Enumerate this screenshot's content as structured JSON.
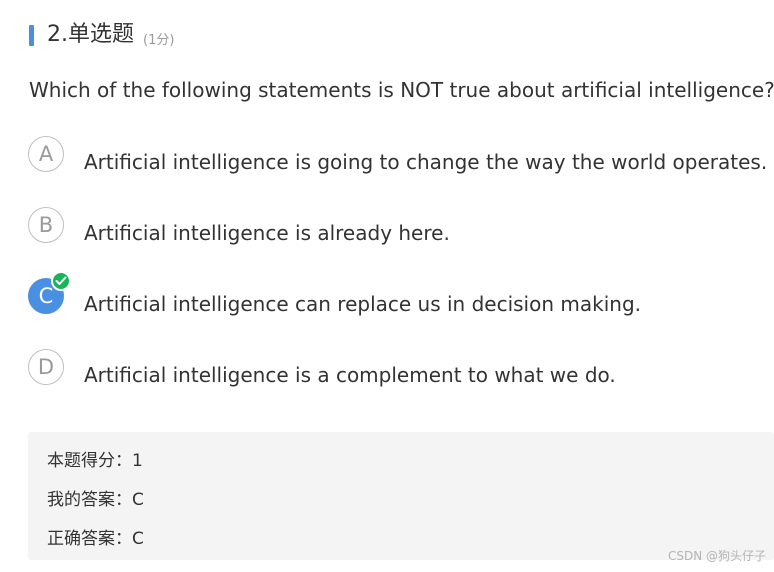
{
  "header": {
    "title": "2.单选题",
    "points": "(1分)",
    "accent_color": "#4A90E2"
  },
  "question": {
    "text": "Which of the following statements is NOT true about artificial intelligence?"
  },
  "options": [
    {
      "letter": "A",
      "text": "Artificial intelligence is going to change the way the world operates.",
      "selected": false
    },
    {
      "letter": "B",
      "text": "Artificial intelligence is already here.",
      "selected": false
    },
    {
      "letter": "C",
      "text": "Artificial intelligence can replace us in decision making.",
      "selected": true,
      "marked_correct": true
    },
    {
      "letter": "D",
      "text": "Artificial intelligence is a complement to what we do.",
      "selected": false
    }
  ],
  "result": {
    "score_label": "本题得分：",
    "score_value": "1",
    "my_answer_label": "我的答案：",
    "my_answer_value": "C",
    "correct_answer_label": "正确答案：",
    "correct_answer_value": "C"
  },
  "icons": {
    "check": "check-circle-icon"
  },
  "colors": {
    "selected": "#4A90E2",
    "correct": "#19b35a"
  },
  "watermark": "CSDN @狗头仔子"
}
